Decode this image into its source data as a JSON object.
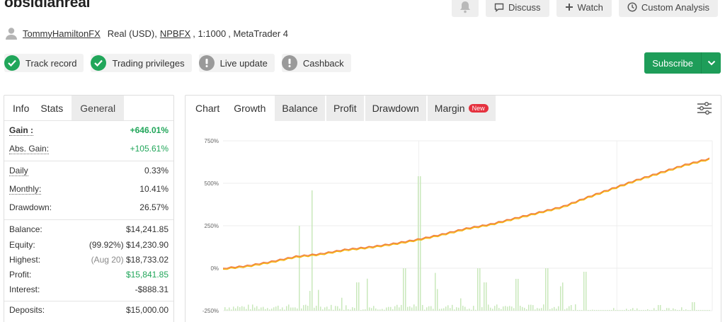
{
  "header": {
    "title": "obsidianreal",
    "actions": {
      "bell_icon": "bell-icon",
      "discuss": "Discuss",
      "watch": "Watch",
      "custom_analysis": "Custom Analysis"
    }
  },
  "account": {
    "user": "TommyHamiltonFX",
    "type": "Real (USD),",
    "broker": "NPBFX",
    "leverage": ", 1:1000",
    "platform": ", MetaTrader 4"
  },
  "badges": [
    {
      "label": "Track record",
      "status": "ok"
    },
    {
      "label": "Trading privileges",
      "status": "ok"
    },
    {
      "label": "Live update",
      "status": "warn"
    },
    {
      "label": "Cashback",
      "status": "warn"
    }
  ],
  "subscribe": {
    "label": "Subscribe"
  },
  "left_tabs": [
    "Info",
    "Stats",
    "General"
  ],
  "stats": {
    "gain": {
      "label": "Gain :",
      "value": "+646.01%"
    },
    "abs_gain": {
      "label": "Abs. Gain:",
      "value": "+105.61%"
    },
    "daily": {
      "label": "Daily",
      "value": "0.33%"
    },
    "monthly": {
      "label": "Monthly:",
      "value": "10.41%"
    },
    "drawdown": {
      "label": "Drawdown:",
      "value": "26.57%"
    },
    "balance": {
      "label": "Balance:",
      "value": "$14,241.85"
    },
    "equity": {
      "label": "Equity:",
      "paren": "(99.92%)",
      "value": "$14,230.90"
    },
    "highest": {
      "label": "Highest:",
      "paren": "(Aug 20)",
      "value": "$18,733.02"
    },
    "profit": {
      "label": "Profit:",
      "value": "$15,841.85"
    },
    "interest": {
      "label": "Interest:",
      "value": "-$888.31"
    },
    "deposits": {
      "label": "Deposits:",
      "value": "$15,000.00"
    }
  },
  "chart_tabs": {
    "chart": "Chart",
    "growth": "Growth",
    "balance": "Balance",
    "profit": "Profit",
    "drawdown": "Drawdown",
    "margin": "Margin",
    "new": "New"
  },
  "colors": {
    "green": "#21a65a",
    "growth_line": "#f07a3a",
    "equity_line": "#f5b400",
    "volume_bars": "#c9e8bb",
    "new_badge": "#e5323f"
  },
  "chart_data": {
    "type": "line",
    "y_ticks": [
      "750%",
      "500%",
      "250%",
      "0%",
      "-250%"
    ],
    "ylim": [
      -250,
      750
    ],
    "grid": true,
    "series": [
      {
        "x_index": [
          0,
          5,
          10,
          15,
          20,
          25,
          30,
          35,
          40,
          45,
          50,
          55,
          60,
          65,
          70,
          75,
          80,
          85,
          90,
          95,
          100
        ],
        "values": [
          0,
          15,
          40,
          70,
          85,
          110,
          125,
          145,
          170,
          200,
          235,
          260,
          295,
          330,
          365,
          420,
          470,
          520,
          565,
          610,
          646
        ]
      }
    ]
  }
}
